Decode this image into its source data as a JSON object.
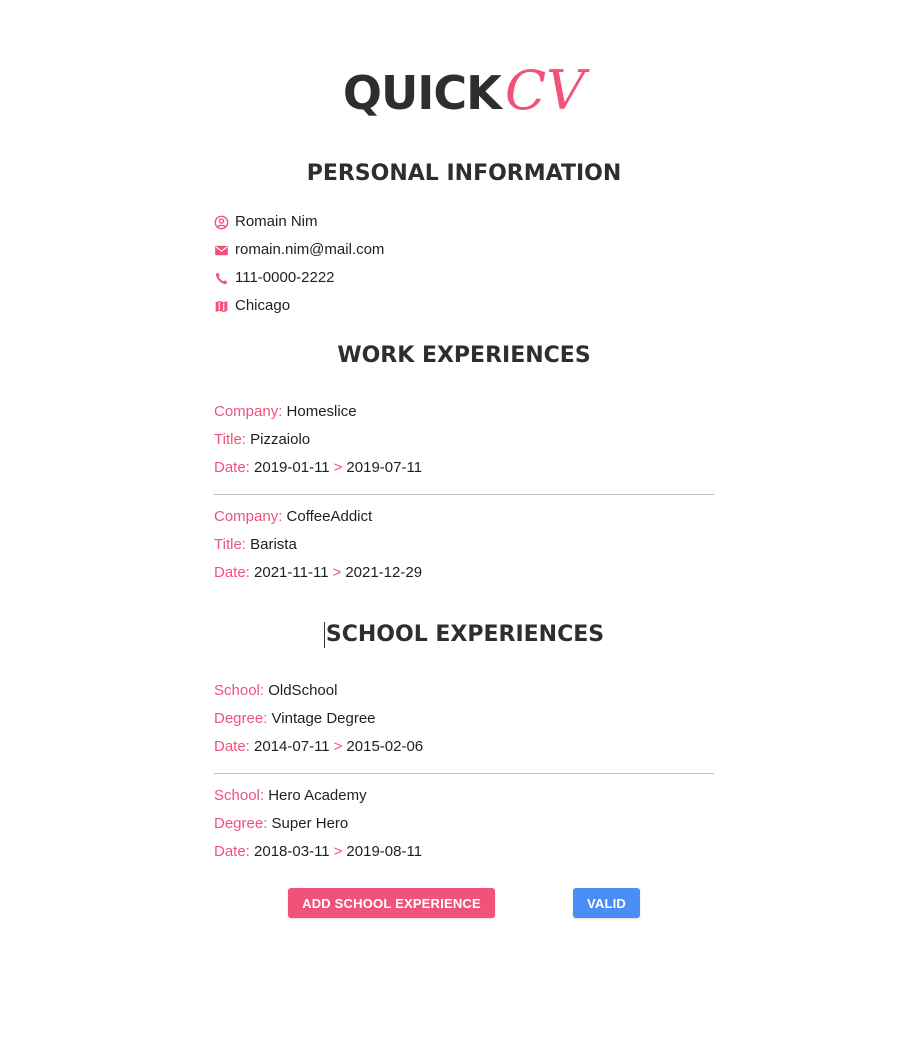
{
  "logo": {
    "quick": "QUICK",
    "cv": "CV"
  },
  "colors": {
    "accent": "#f0527a",
    "primary_button": "#4a8ef5",
    "heading": "#2e2e2e"
  },
  "personal": {
    "title": "PERSONAL INFORMATION",
    "items": [
      {
        "icon": "user-circle-icon",
        "value": "Romain Nim"
      },
      {
        "icon": "mail-icon",
        "value": "romain.nim@mail.com"
      },
      {
        "icon": "phone-icon",
        "value": "111-0000-2222"
      },
      {
        "icon": "map-icon",
        "value": "Chicago"
      }
    ]
  },
  "work": {
    "title": "WORK EXPERIENCES",
    "labels": {
      "company": "Company:",
      "title": "Title:",
      "date": "Date:",
      "separator": ">"
    },
    "entries": [
      {
        "company": "Homeslice",
        "title": "Pizzaiolo",
        "start": "2019-01-11",
        "end": "2019-07-11"
      },
      {
        "company": "CoffeeAddict",
        "title": "Barista",
        "start": "2021-11-11",
        "end": "2021-12-29"
      }
    ]
  },
  "school": {
    "title": "SCHOOL EXPERIENCES",
    "labels": {
      "school": "School:",
      "degree": "Degree:",
      "date": "Date:",
      "separator": ">"
    },
    "entries": [
      {
        "school": "OldSchool",
        "degree": "Vintage Degree",
        "start": "2014-07-11",
        "end": "2015-02-06"
      },
      {
        "school": "Hero Academy",
        "degree": "Super Hero",
        "start": "2018-03-11",
        "end": "2019-08-11"
      }
    ]
  },
  "actions": {
    "add_school": "ADD SCHOOL EXPERIENCE",
    "valid": "VALID"
  }
}
